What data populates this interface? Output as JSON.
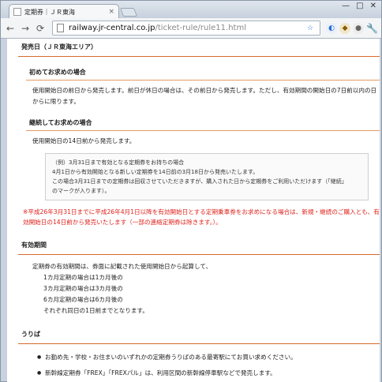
{
  "browser": {
    "tab_title": "定期券｜ＪＲ東海",
    "tab_close": "×",
    "win_minimize": "—",
    "win_maximize": "□",
    "win_close": "✕",
    "url_host": "railway.jr-central.co.jp",
    "url_path": "/ticket-rule/rule11.html"
  },
  "content": {
    "section1_title": "発売日（ＪＲ東海エリア）",
    "sub1_title": "初めてお求めの場合",
    "sub1_text": "使用開始日の前日から発売します。前日が休日の場合は、その前日から発売します。ただし、有効期間の開始日の7日前以内の日からに限ります。",
    "sub2_title": "継続してお求めの場合",
    "sub2_text": "使用開始日の14日前から発売します。",
    "example_line1": "（例）3月31日まで有効となる定期券をお持ちの場合",
    "example_line2": "4月1日から有効開始となる新しい定期券を14日前の3月18日から発売いたします。",
    "example_line3": "この場合3月31日までの定期券は回収させていただきますが、購入された日から定期券をご利用いただけます（「継続」",
    "example_line4": "のマークが入ります）。",
    "notice": "※平成26年3月31日までに平成26年4月1日以降を有効開始日とする定期乗車券をお求めになる場合は、新規・継続のご購入とも、有効開始日の14日前から発売いたします（一部の連絡定期券は除きます。）。",
    "section2_title": "有効期間",
    "validity_intro": "定期券の有効期間は、券面に記載された使用開始日から起算して、",
    "validity_1": "1カ月定期の場合は1カ月後の",
    "validity_3": "3カ月定期の場合は3カ月後の",
    "validity_6": "6カ月定期の場合は6カ月後の",
    "validity_end": "それぞれ同日の1日前までとなります。",
    "section3_title": "うりば",
    "bullet1": "お勤め先・学校・お住まいのいずれかの定期券うりばのある最寄駅にてお買い求めください。",
    "bullet2": "新幹線定期券「FREX」「FREXパル」は、利用区間の新幹線停車駅などで発売します。"
  },
  "colors": {
    "accent_line": "#d86a2a",
    "notice_red": "#e0221b"
  }
}
